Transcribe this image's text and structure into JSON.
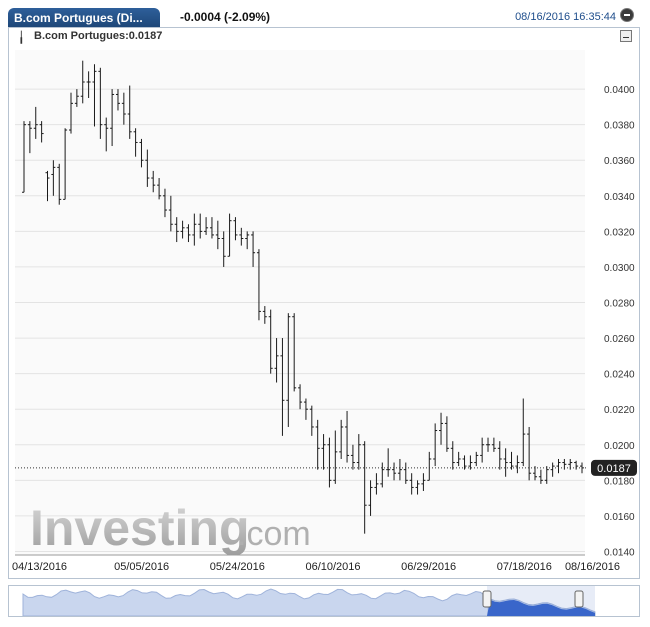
{
  "header": {
    "tab_title": "B.com Portugues (Di...",
    "change": "-0.0004 (-2.09%)",
    "datetime": "08/16/2016 16:35:44"
  },
  "legend": {
    "text": "B.com Portugues:0.0187"
  },
  "watermark": {
    "brand": "Investing",
    "suffix": ".com"
  },
  "colors": {
    "bars": "#1a1a1a",
    "grid": "#e3e3e3",
    "badge": "#222222",
    "navigator_fill": "#c9d6ee",
    "navigator_selected": "#2b5cc9"
  },
  "chart_data": {
    "type": "ohlc",
    "current_value": 0.0187,
    "current_label": "0.0187",
    "ylim": [
      0.0138,
      0.0422
    ],
    "y_ticks": [
      "0.0140",
      "0.0160",
      "0.0180",
      "0.0200",
      "0.0220",
      "0.0240",
      "0.0260",
      "0.0280",
      "0.0300",
      "0.0320",
      "0.0340",
      "0.0360",
      "0.0380",
      "0.0400"
    ],
    "x_ticks": [
      "04/13/2016",
      "05/05/2016",
      "05/24/2016",
      "06/10/2016",
      "06/29/2016",
      "07/18/2016",
      "08/16/2016"
    ],
    "bars": [
      [
        0.0342,
        0.0382,
        0.0342,
        0.038
      ],
      [
        0.038,
        0.0382,
        0.0364,
        0.0378
      ],
      [
        0.0378,
        0.039,
        0.0372,
        0.038
      ],
      [
        0.038,
        0.0382,
        0.037,
        0.0375
      ],
      [
        0.0353,
        0.0354,
        0.0337,
        0.035
      ],
      [
        0.0352,
        0.036,
        0.034,
        0.0356
      ],
      [
        0.0356,
        0.0358,
        0.0335,
        0.0338
      ],
      [
        0.0338,
        0.0378,
        0.0338,
        0.0377
      ],
      [
        0.0377,
        0.0398,
        0.0375,
        0.0392
      ],
      [
        0.0392,
        0.04,
        0.039,
        0.0396
      ],
      [
        0.0396,
        0.0416,
        0.0392,
        0.0404
      ],
      [
        0.0404,
        0.041,
        0.0395,
        0.0404
      ],
      [
        0.0404,
        0.0414,
        0.0379,
        0.041
      ],
      [
        0.041,
        0.0412,
        0.0372,
        0.038
      ],
      [
        0.038,
        0.0384,
        0.0365,
        0.0378
      ],
      [
        0.0378,
        0.04,
        0.0368,
        0.0397
      ],
      [
        0.0397,
        0.04,
        0.0388,
        0.0392
      ],
      [
        0.0392,
        0.0398,
        0.038,
        0.0386
      ],
      [
        0.0386,
        0.0402,
        0.0372,
        0.0376
      ],
      [
        0.0376,
        0.0378,
        0.0362,
        0.037
      ],
      [
        0.037,
        0.0372,
        0.0356,
        0.036
      ],
      [
        0.036,
        0.0366,
        0.0345,
        0.035
      ],
      [
        0.035,
        0.0354,
        0.0342,
        0.0346
      ],
      [
        0.0346,
        0.035,
        0.0338,
        0.034
      ],
      [
        0.034,
        0.0344,
        0.0328,
        0.0332
      ],
      [
        0.0332,
        0.034,
        0.032,
        0.0324
      ],
      [
        0.0324,
        0.0328,
        0.0314,
        0.032
      ],
      [
        0.032,
        0.0326,
        0.0316,
        0.0322
      ],
      [
        0.0322,
        0.0324,
        0.0314,
        0.0318
      ],
      [
        0.0318,
        0.033,
        0.0312,
        0.0324
      ],
      [
        0.0324,
        0.033,
        0.0316,
        0.032
      ],
      [
        0.032,
        0.0328,
        0.0318,
        0.0322
      ],
      [
        0.0322,
        0.0328,
        0.0316,
        0.0318
      ],
      [
        0.0318,
        0.0326,
        0.031,
        0.0316
      ],
      [
        0.0316,
        0.032,
        0.03,
        0.0306
      ],
      [
        0.0306,
        0.033,
        0.0306,
        0.0326
      ],
      [
        0.0326,
        0.0328,
        0.0315,
        0.0318
      ],
      [
        0.0318,
        0.0322,
        0.0312,
        0.0316
      ],
      [
        0.0316,
        0.032,
        0.031,
        0.0318
      ],
      [
        0.0318,
        0.032,
        0.03,
        0.0308
      ],
      [
        0.0308,
        0.031,
        0.027,
        0.0275
      ],
      [
        0.0275,
        0.0278,
        0.0268,
        0.0272
      ],
      [
        0.0272,
        0.0276,
        0.024,
        0.0243
      ],
      [
        0.0243,
        0.026,
        0.0235,
        0.025
      ],
      [
        0.025,
        0.026,
        0.0205,
        0.0225
      ],
      [
        0.0225,
        0.0274,
        0.021,
        0.0272
      ],
      [
        0.0272,
        0.0274,
        0.023,
        0.0232
      ],
      [
        0.0232,
        0.0234,
        0.022,
        0.0224
      ],
      [
        0.0224,
        0.0226,
        0.0214,
        0.022
      ],
      [
        0.022,
        0.0222,
        0.0205,
        0.021
      ],
      [
        0.021,
        0.0214,
        0.0186,
        0.0198
      ],
      [
        0.0198,
        0.0206,
        0.0186,
        0.02
      ],
      [
        0.02,
        0.0204,
        0.0176,
        0.018
      ],
      [
        0.018,
        0.0208,
        0.0178,
        0.0196
      ],
      [
        0.0196,
        0.0214,
        0.0192,
        0.021
      ],
      [
        0.021,
        0.0219,
        0.019,
        0.0194
      ],
      [
        0.0194,
        0.02,
        0.0186,
        0.019
      ],
      [
        0.019,
        0.0206,
        0.0186,
        0.02
      ],
      [
        0.02,
        0.0202,
        0.015,
        0.0166
      ],
      [
        0.0166,
        0.018,
        0.016,
        0.0176
      ],
      [
        0.0176,
        0.0184,
        0.0172,
        0.0178
      ],
      [
        0.0178,
        0.019,
        0.0176,
        0.0186
      ],
      [
        0.0186,
        0.0198,
        0.0182,
        0.0186
      ],
      [
        0.0186,
        0.019,
        0.018,
        0.0184
      ],
      [
        0.0184,
        0.0192,
        0.018,
        0.0186
      ],
      [
        0.0186,
        0.019,
        0.0178,
        0.018
      ],
      [
        0.018,
        0.0184,
        0.0172,
        0.0176
      ],
      [
        0.0176,
        0.018,
        0.0172,
        0.0178
      ],
      [
        0.0178,
        0.0184,
        0.0174,
        0.018
      ],
      [
        0.018,
        0.0196,
        0.018,
        0.0192
      ],
      [
        0.0192,
        0.0212,
        0.0188,
        0.0208
      ],
      [
        0.0208,
        0.0218,
        0.02,
        0.0212
      ],
      [
        0.0212,
        0.0216,
        0.0196,
        0.0198
      ],
      [
        0.0198,
        0.0202,
        0.0186,
        0.019
      ],
      [
        0.019,
        0.0196,
        0.0188,
        0.0192
      ],
      [
        0.0192,
        0.0194,
        0.0186,
        0.0188
      ],
      [
        0.0188,
        0.0194,
        0.0186,
        0.019
      ],
      [
        0.019,
        0.0196,
        0.0188,
        0.0194
      ],
      [
        0.0194,
        0.0204,
        0.019,
        0.02
      ],
      [
        0.02,
        0.0204,
        0.0196,
        0.02
      ],
      [
        0.02,
        0.0204,
        0.0196,
        0.0198
      ],
      [
        0.0198,
        0.0202,
        0.0186,
        0.0192
      ],
      [
        0.0192,
        0.0198,
        0.0182,
        0.019
      ],
      [
        0.019,
        0.0196,
        0.0186,
        0.0188
      ],
      [
        0.0188,
        0.0194,
        0.0184,
        0.019
      ],
      [
        0.019,
        0.0226,
        0.0188,
        0.0206
      ],
      [
        0.0206,
        0.021,
        0.018,
        0.0184
      ],
      [
        0.0184,
        0.0188,
        0.018,
        0.0182
      ],
      [
        0.0182,
        0.0186,
        0.0178,
        0.018
      ],
      [
        0.018,
        0.0188,
        0.0178,
        0.0186
      ],
      [
        0.0186,
        0.019,
        0.0182,
        0.0188
      ],
      [
        0.0188,
        0.0192,
        0.0184,
        0.019
      ],
      [
        0.019,
        0.0192,
        0.0186,
        0.0189
      ],
      [
        0.0189,
        0.0192,
        0.0186,
        0.019
      ],
      [
        0.019,
        0.0191,
        0.0186,
        0.0188
      ],
      [
        0.0188,
        0.019,
        0.0184,
        0.0187
      ]
    ]
  }
}
